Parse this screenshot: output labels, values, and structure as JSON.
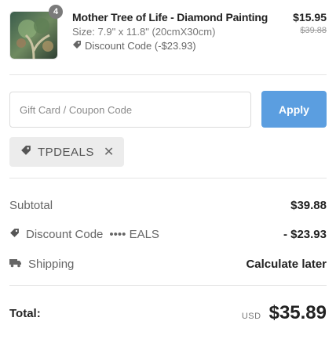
{
  "item": {
    "quantity": "4",
    "title": "Mother Tree of Life - Diamond Painting",
    "size": "Size: 7.9\" x 11.8\" (20cmX30cm)",
    "discount": "Discount Code (-$23.93)",
    "price": "$15.95",
    "original_price": "$39.88"
  },
  "coupon": {
    "placeholder": "Gift Card / Coupon Code",
    "value": "",
    "apply_label": "Apply"
  },
  "applied_tag": {
    "code": "TPDEALS",
    "close_symbol": "✕"
  },
  "summary": {
    "subtotal_label": "Subtotal",
    "subtotal_value": "$39.88",
    "discount_label": "Discount Code",
    "discount_masked": "•••• EALS",
    "discount_value": "- $23.93",
    "shipping_label": "Shipping",
    "shipping_value": "Calculate later"
  },
  "total": {
    "label": "Total:",
    "currency": "USD",
    "value": "$35.89"
  },
  "colors": {
    "accent": "#5b9ee0",
    "tag_bg": "#ececec",
    "divider": "#e5e5e5"
  }
}
